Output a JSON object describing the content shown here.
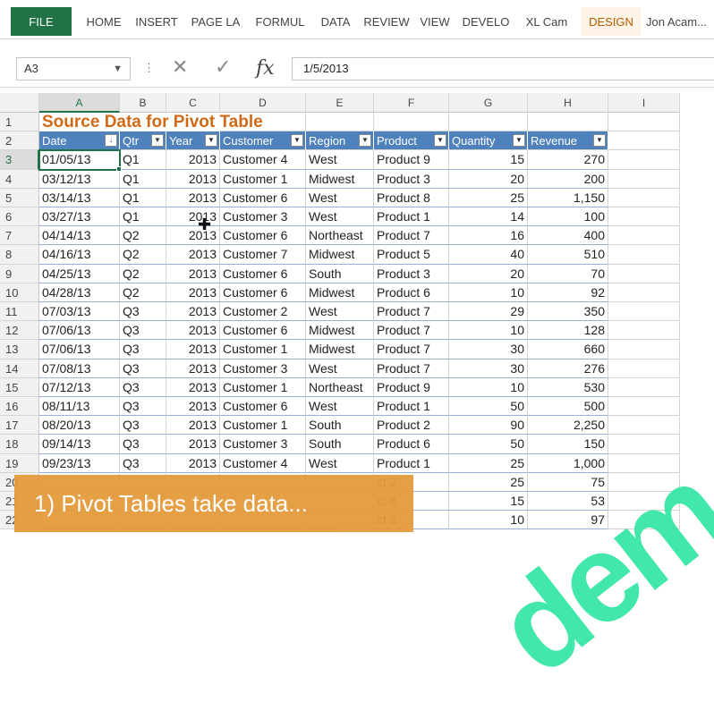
{
  "ribbon": {
    "file_label": "FILE",
    "tabs": [
      "HOME",
      "INSERT",
      "PAGE LA",
      "FORMUL",
      "DATA",
      "REVIEW",
      "VIEW",
      "DEVELO",
      "XL Cam",
      "DESIGN",
      "Jon Acam..."
    ]
  },
  "formula_bar": {
    "name_box": "A3",
    "fx_label": "fx",
    "value": "1/5/2013"
  },
  "columns": [
    "A",
    "B",
    "C",
    "D",
    "E",
    "F",
    "G",
    "H",
    "I"
  ],
  "row_numbers": [
    "1",
    "2",
    "3",
    "4",
    "5",
    "6",
    "7",
    "8",
    "9",
    "10",
    "11",
    "12",
    "13",
    "14",
    "15",
    "16",
    "17",
    "18",
    "19",
    "20",
    "21",
    "22"
  ],
  "title": "Source Data for Pivot Table",
  "headers": [
    "Date",
    "Qtr",
    "Year",
    "Customer",
    "Region",
    "Product",
    "Quantity",
    "Revenue"
  ],
  "rows": [
    [
      "01/05/13",
      "Q1",
      "2013",
      "Customer 4",
      "West",
      "Product 9",
      "15",
      "270"
    ],
    [
      "03/12/13",
      "Q1",
      "2013",
      "Customer 1",
      "Midwest",
      "Product 3",
      "20",
      "200"
    ],
    [
      "03/14/13",
      "Q1",
      "2013",
      "Customer 6",
      "West",
      "Product 8",
      "25",
      "1,150"
    ],
    [
      "03/27/13",
      "Q1",
      "2013",
      "Customer 3",
      "West",
      "Product 1",
      "14",
      "100"
    ],
    [
      "04/14/13",
      "Q2",
      "2013",
      "Customer 6",
      "Northeast",
      "Product 7",
      "16",
      "400"
    ],
    [
      "04/16/13",
      "Q2",
      "2013",
      "Customer 7",
      "Midwest",
      "Product 5",
      "40",
      "510"
    ],
    [
      "04/25/13",
      "Q2",
      "2013",
      "Customer 6",
      "South",
      "Product 3",
      "20",
      "70"
    ],
    [
      "04/28/13",
      "Q2",
      "2013",
      "Customer 6",
      "Midwest",
      "Product 6",
      "10",
      "92"
    ],
    [
      "07/03/13",
      "Q3",
      "2013",
      "Customer 2",
      "West",
      "Product 7",
      "29",
      "350"
    ],
    [
      "07/06/13",
      "Q3",
      "2013",
      "Customer 6",
      "Midwest",
      "Product 7",
      "10",
      "128"
    ],
    [
      "07/06/13",
      "Q3",
      "2013",
      "Customer 1",
      "Midwest",
      "Product 7",
      "30",
      "660"
    ],
    [
      "07/08/13",
      "Q3",
      "2013",
      "Customer 3",
      "West",
      "Product 7",
      "30",
      "276"
    ],
    [
      "07/12/13",
      "Q3",
      "2013",
      "Customer 1",
      "Northeast",
      "Product 9",
      "10",
      "530"
    ],
    [
      "08/11/13",
      "Q3",
      "2013",
      "Customer 6",
      "West",
      "Product 1",
      "50",
      "500"
    ],
    [
      "08/20/13",
      "Q3",
      "2013",
      "Customer 1",
      "South",
      "Product 2",
      "90",
      "2,250"
    ],
    [
      "09/14/13",
      "Q3",
      "2013",
      "Customer 3",
      "South",
      "Product 6",
      "50",
      "150"
    ],
    [
      "09/23/13",
      "Q3",
      "2013",
      "Customer 4",
      "West",
      "Product 1",
      "25",
      "1,000"
    ],
    [
      "",
      "",
      "",
      "",
      "",
      "ct 2",
      "25",
      "75"
    ],
    [
      "",
      "",
      "",
      "",
      "",
      "ct 6",
      "15",
      "53"
    ],
    [
      "",
      "",
      "",
      "",
      "",
      "ct 3",
      "10",
      "97"
    ]
  ],
  "callout": "1) Pivot Tables take data...",
  "watermark": "dem",
  "colors": {
    "accent": "#217346",
    "header_fill": "#4f81bd",
    "title": "#d06a16",
    "callout": "#e49a3c",
    "watermark": "#2ee6a0"
  }
}
